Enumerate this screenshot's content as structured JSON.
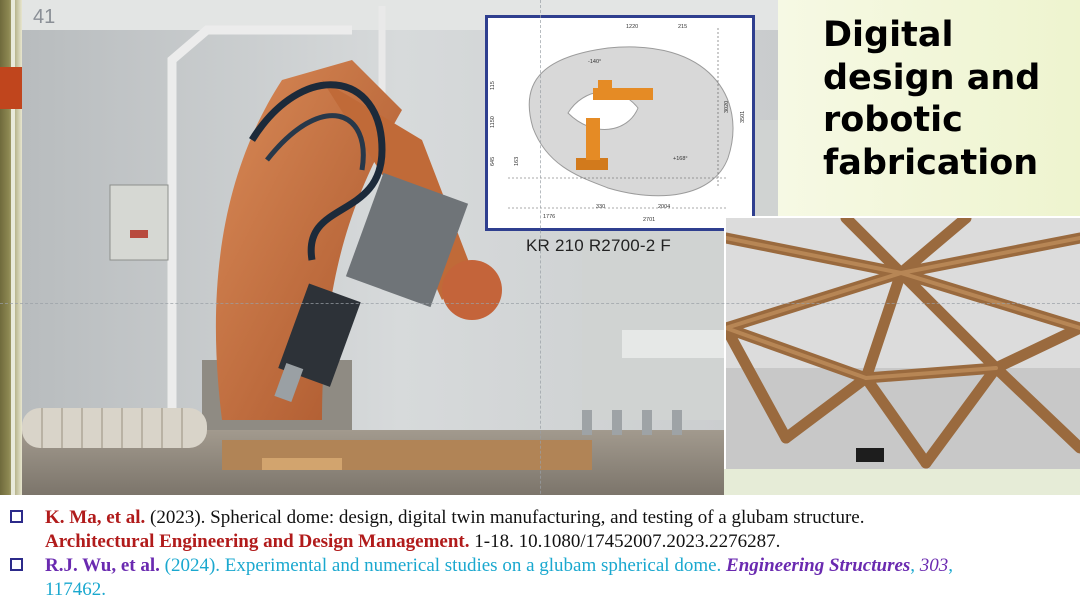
{
  "slide": {
    "number": "41",
    "title": "Digital design and robotic fabrication"
  },
  "diagram": {
    "caption": "KR 210 R2700-2 F",
    "dims": {
      "d1220": "1220",
      "d215": "215",
      "d115": "115",
      "d1150": "1150",
      "d645": "645",
      "d163": "163",
      "d3020": "3020",
      "d3501": "3501",
      "d1776": "1776",
      "d330": "330",
      "d2004": "2004",
      "d2701": "2701",
      "a140": "-140°",
      "a168": "+168°"
    }
  },
  "references": [
    {
      "authors": "K. Ma, et al.",
      "year": " (2023).",
      "title": " Spherical dome: design, digital twin manufacturing, and testing of a glubam structure.",
      "journal": "Architectural Engineering and Design Management.",
      "details": " 1-18. 10.1080/17452007.2023.2276287."
    },
    {
      "authors": "R.J. Wu, et al.",
      "year": " (2024).",
      "title": " Experimental and numerical studies on a glubam spherical dome.",
      "journal": "Engineering Structures",
      "sep": ", ",
      "volume": "303",
      "details": ",",
      "pages": "117462."
    }
  ],
  "colors": {
    "red_tab": "#c0451d",
    "title_bg": "#eef4cf",
    "diagram_border": "#2f3f8f",
    "ref_red": "#b11b1b",
    "ref_cyan": "#1aa8cf",
    "ref_purple": "#6a2ab0"
  }
}
